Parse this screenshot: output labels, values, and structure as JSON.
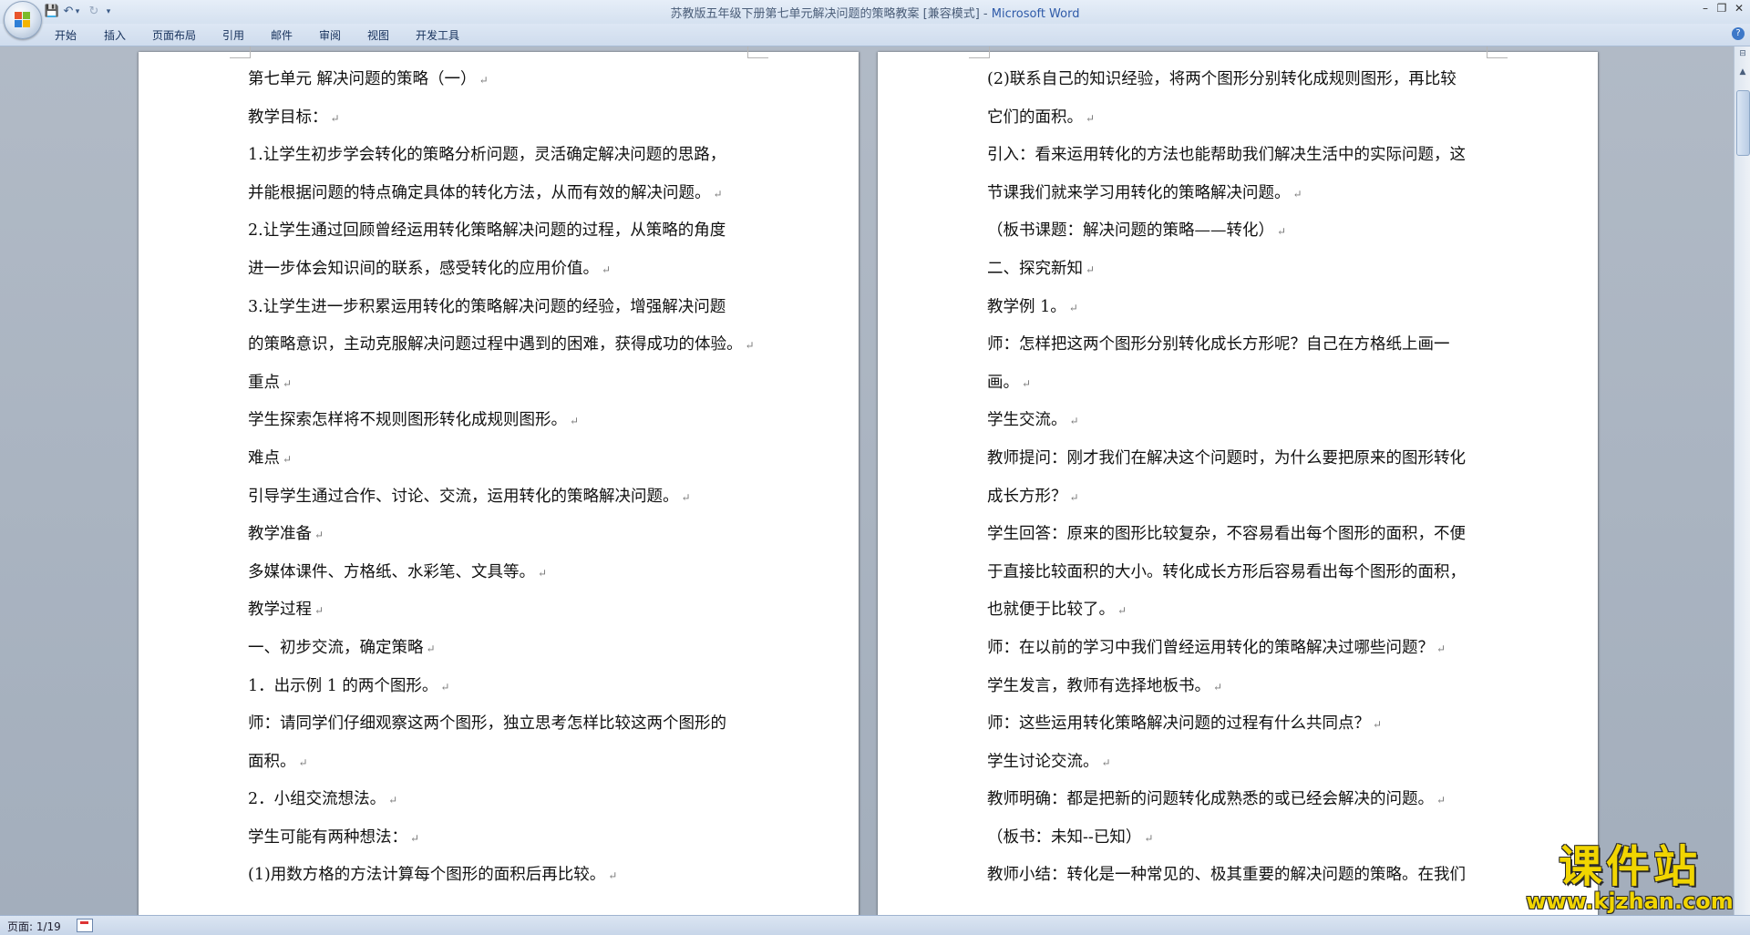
{
  "window": {
    "title_doc": "苏教版五年级下册第七单元解决问题的策略教案 [兼容模式]",
    "title_sep": " - ",
    "title_app": "Microsoft Word",
    "minimize": "–",
    "restore": "❐",
    "close": "✕"
  },
  "quick_access": {
    "save": "💾",
    "undo": "↶",
    "undo_more": "▾",
    "redo": "↻",
    "customize": "▾"
  },
  "ribbon_tabs": [
    "开始",
    "插入",
    "页面布局",
    "引用",
    "邮件",
    "审阅",
    "视图",
    "开发工具"
  ],
  "help": "?",
  "left_page": {
    "lines": [
      "第七单元 解决问题的策略（一）",
      "教学目标：",
      "1.让学生初步学会转化的策略分析问题，灵活确定解决问题的思路，",
      "并能根据问题的特点确定具体的转化方法，从而有效的解决问题。",
      "2.让学生通过回顾曾经运用转化策略解决问题的过程，从策略的角度",
      "进一步体会知识间的联系，感受转化的应用价值。",
      "3.让学生进一步积累运用转化的策略解决问题的经验，增强解决问题",
      "的策略意识，主动克服解决问题过程中遇到的困难，获得成功的体验。",
      "重点",
      "学生探索怎样将不规则图形转化成规则图形。",
      "难点",
      "引导学生通过合作、讨论、交流，运用转化的策略解决问题。",
      "教学准备",
      "多媒体课件、方格纸、水彩笔、文具等。",
      "教学过程",
      "一、初步交流，确定策略",
      "1．出示例 1 的两个图形。",
      "师：请同学们仔细观察这两个图形，独立思考怎样比较这两个图形的",
      "面积。",
      "2．小组交流想法。",
      "学生可能有两种想法：",
      "(1)用数方格的方法计算每个图形的面积后再比较。"
    ]
  },
  "right_page": {
    "lines": [
      "(2)联系自己的知识经验，将两个图形分别转化成规则图形，再比较",
      "它们的面积。",
      "引入：看来运用转化的方法也能帮助我们解决生活中的实际问题，这",
      "节课我们就来学习用转化的策略解决问题。",
      "（板书课题：解决问题的策略——转化）",
      "二、探究新知",
      "教学例 1。",
      "师：怎样把这两个图形分别转化成长方形呢？自己在方格纸上画一",
      "画。",
      "学生交流。",
      "教师提问：刚才我们在解决这个问题时，为什么要把原来的图形转化",
      "成长方形？",
      "学生回答：原来的图形比较复杂，不容易看出每个图形的面积，不便",
      "于直接比较面积的大小。转化成长方形后容易看出每个图形的面积，",
      "也就便于比较了。",
      "师：在以前的学习中我们曾经运用转化的策略解决过哪些问题？",
      "学生发言，教师有选择地板书。",
      "师：这些运用转化策略解决问题的过程有什么共同点？",
      "学生讨论交流。",
      "教师明确：都是把新的问题转化成熟悉的或已经会解决的问题。",
      "（板书：未知--已知）",
      "教师小结：转化是一种常见的、极其重要的解决问题的策略。在我们"
    ]
  },
  "paragraph_mark": "↵",
  "line_ends_with_mark": [
    [
      true,
      true,
      false,
      true,
      false,
      true,
      false,
      true,
      true,
      true,
      true,
      true,
      true,
      true,
      true,
      true,
      true,
      false,
      true,
      true,
      true,
      true
    ],
    [
      false,
      true,
      false,
      true,
      true,
      true,
      true,
      false,
      true,
      true,
      false,
      true,
      false,
      false,
      true,
      true,
      true,
      true,
      true,
      true,
      true,
      false
    ]
  ],
  "statusbar": {
    "page": "页面: 1/19"
  },
  "scrollbar": {
    "up": "▲"
  },
  "watermark": {
    "title": "课件站",
    "url": "www.kjzhan.com"
  },
  "colors": {
    "workspace": "#a9b3c0",
    "title_app": "#2e5aa8",
    "watermark": "#f1d500"
  }
}
